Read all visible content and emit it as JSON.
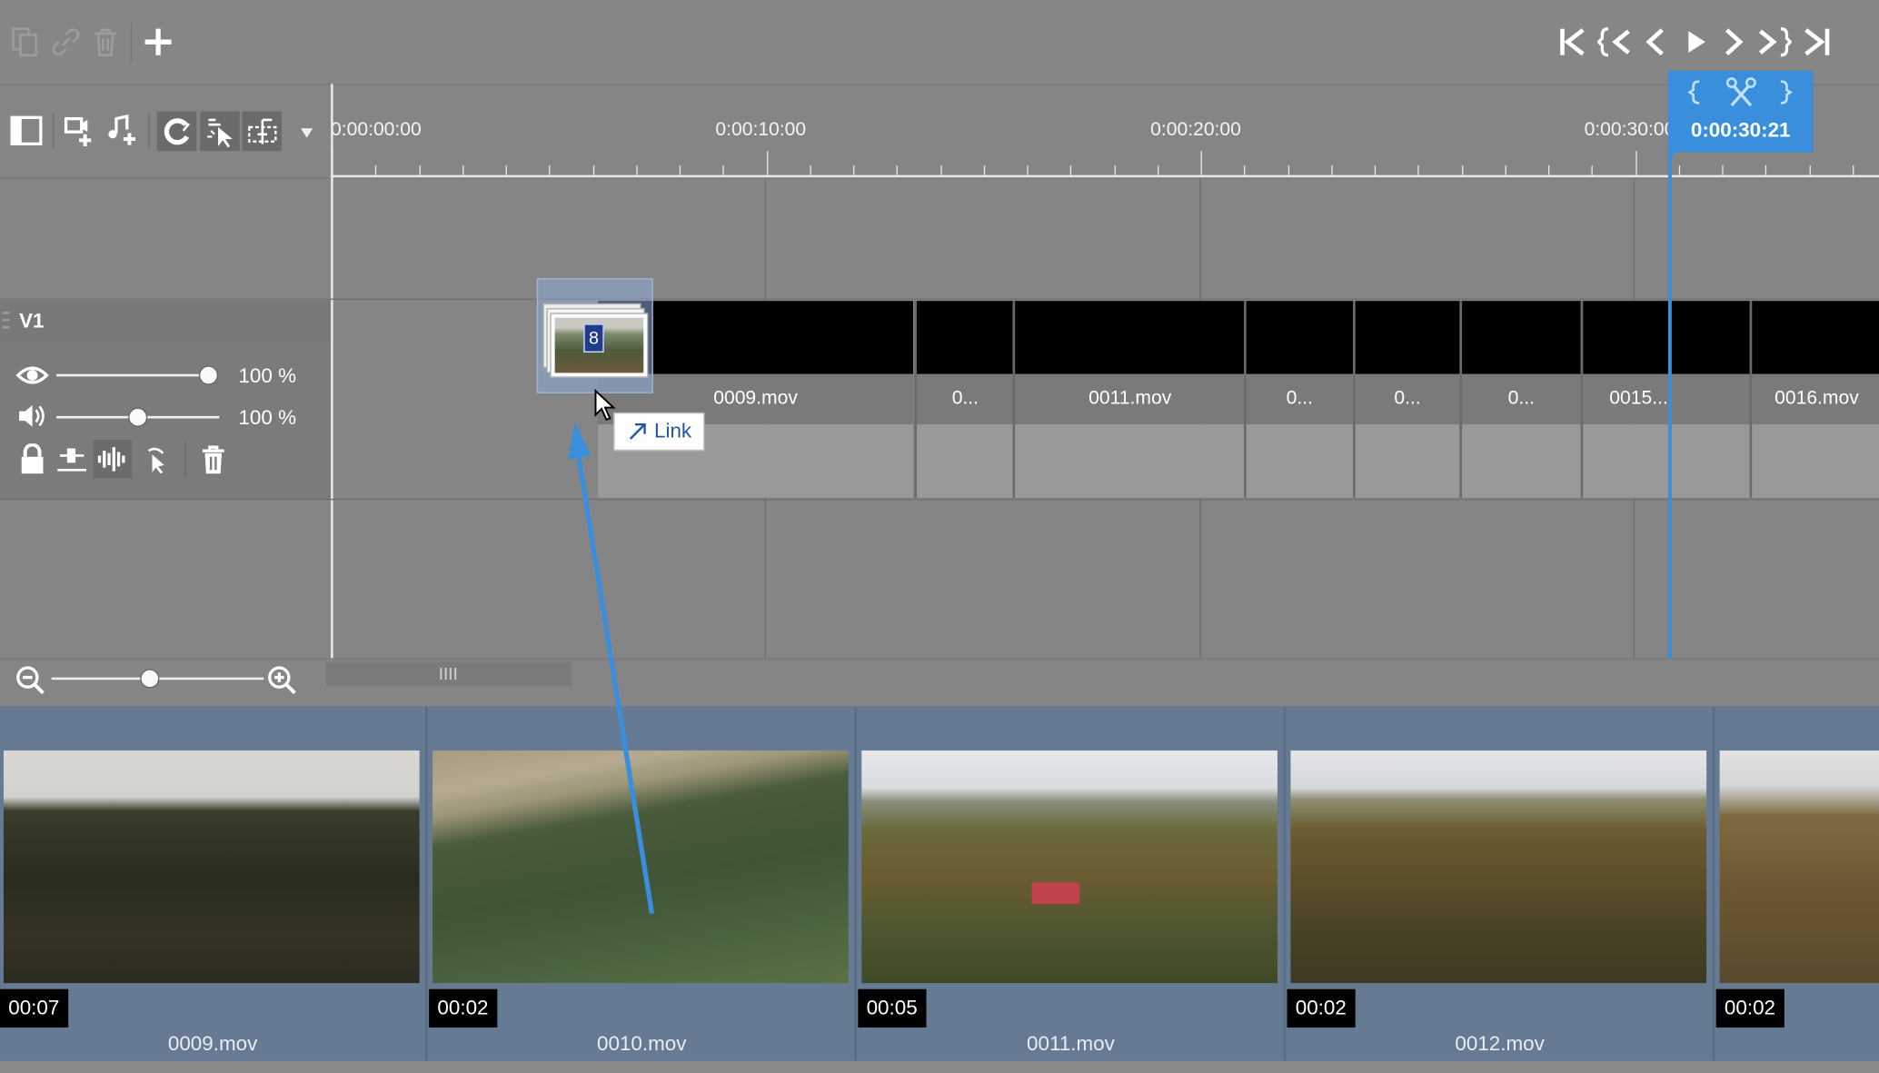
{
  "toolbar": {
    "icons": [
      "copy-icon",
      "link-icon",
      "trash-icon",
      "plus-icon"
    ],
    "transport": [
      "go-to-start-icon",
      "previous-marker-icon",
      "previous-frame-icon",
      "play-icon",
      "next-frame-icon",
      "next-marker-icon",
      "go-to-end-icon"
    ]
  },
  "ruler": {
    "timecodes": [
      "0:00:00:00",
      "0:00:10:00",
      "0:00:20:00",
      "0:00:30:00"
    ]
  },
  "playhead": {
    "time": "0:00:30:21",
    "color": "#3a8fdc"
  },
  "track": {
    "name": "V1",
    "video_opacity_pct": "100 %",
    "audio_volume_pct": "100 %",
    "video_opacity": 1.0,
    "audio_volume": 0.5
  },
  "clips": [
    {
      "name": "0009.mov"
    },
    {
      "name": "0..."
    },
    {
      "name": "0011.mov"
    },
    {
      "name": "0..."
    },
    {
      "name": "0..."
    },
    {
      "name": "0..."
    },
    {
      "name": "0015..."
    },
    {
      "name": "0016.mov"
    }
  ],
  "drag": {
    "count": "8",
    "tooltip": "Link"
  },
  "zoom": {
    "level": 0.5
  },
  "media_bin": [
    {
      "duration": "00:07",
      "filename": "0009.mov"
    },
    {
      "duration": "00:02",
      "filename": "0010.mov"
    },
    {
      "duration": "00:05",
      "filename": "0011.mov"
    },
    {
      "duration": "00:02",
      "filename": "0012.mov"
    },
    {
      "duration": "00:02",
      "filename": ""
    }
  ]
}
